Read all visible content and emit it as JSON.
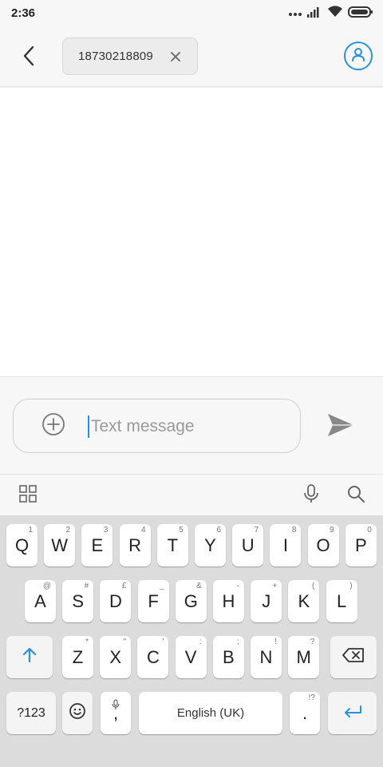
{
  "status_bar": {
    "time": "2:36",
    "icons": [
      "more-dots-icon",
      "signal-icon",
      "wifi-icon",
      "battery-icon"
    ]
  },
  "header": {
    "back_icon": "back-arrow-icon",
    "recipient": "18730218809",
    "remove_recipient_icon": "close-icon",
    "contact_icon": "contact-icon",
    "accent_color": "#2d8fe3"
  },
  "compose": {
    "attach_icon": "add-circle-icon",
    "placeholder": "Text message",
    "value": "",
    "send_icon": "send-icon"
  },
  "keyboard_toolbar": {
    "icons": [
      "grid-icon",
      "microphone-icon",
      "search-icon"
    ]
  },
  "keyboard": {
    "row1": [
      {
        "label": "Q",
        "sub": "1"
      },
      {
        "label": "W",
        "sub": "2"
      },
      {
        "label": "E",
        "sub": "3"
      },
      {
        "label": "R",
        "sub": "4"
      },
      {
        "label": "T",
        "sub": "5"
      },
      {
        "label": "Y",
        "sub": "6"
      },
      {
        "label": "U",
        "sub": "7"
      },
      {
        "label": "I",
        "sub": "8"
      },
      {
        "label": "O",
        "sub": "9"
      },
      {
        "label": "P",
        "sub": "0"
      }
    ],
    "row2": [
      {
        "label": "A",
        "sub": "@"
      },
      {
        "label": "S",
        "sub": "#"
      },
      {
        "label": "D",
        "sub": "£"
      },
      {
        "label": "F",
        "sub": "_"
      },
      {
        "label": "G",
        "sub": "&"
      },
      {
        "label": "H",
        "sub": "-"
      },
      {
        "label": "J",
        "sub": "+"
      },
      {
        "label": "K",
        "sub": "("
      },
      {
        "label": "L",
        "sub": ")"
      }
    ],
    "row3": [
      {
        "label": "Z",
        "sub": "*"
      },
      {
        "label": "X",
        "sub": "\""
      },
      {
        "label": "C",
        "sub": "'"
      },
      {
        "label": "V",
        "sub": ":"
      },
      {
        "label": "B",
        "sub": ";"
      },
      {
        "label": "N",
        "sub": "!"
      },
      {
        "label": "M",
        "sub": "?"
      }
    ],
    "shift_icon": "shift-icon",
    "backspace_icon": "backspace-icon",
    "symbols_label": "?123",
    "emoji_icon": "emoji-icon",
    "comma": {
      "label": ",",
      "sub_icon": "microphone-icon"
    },
    "space_label": "English (UK)",
    "period": {
      "label": ".",
      "sub": "!?"
    },
    "enter_icon": "enter-icon"
  }
}
